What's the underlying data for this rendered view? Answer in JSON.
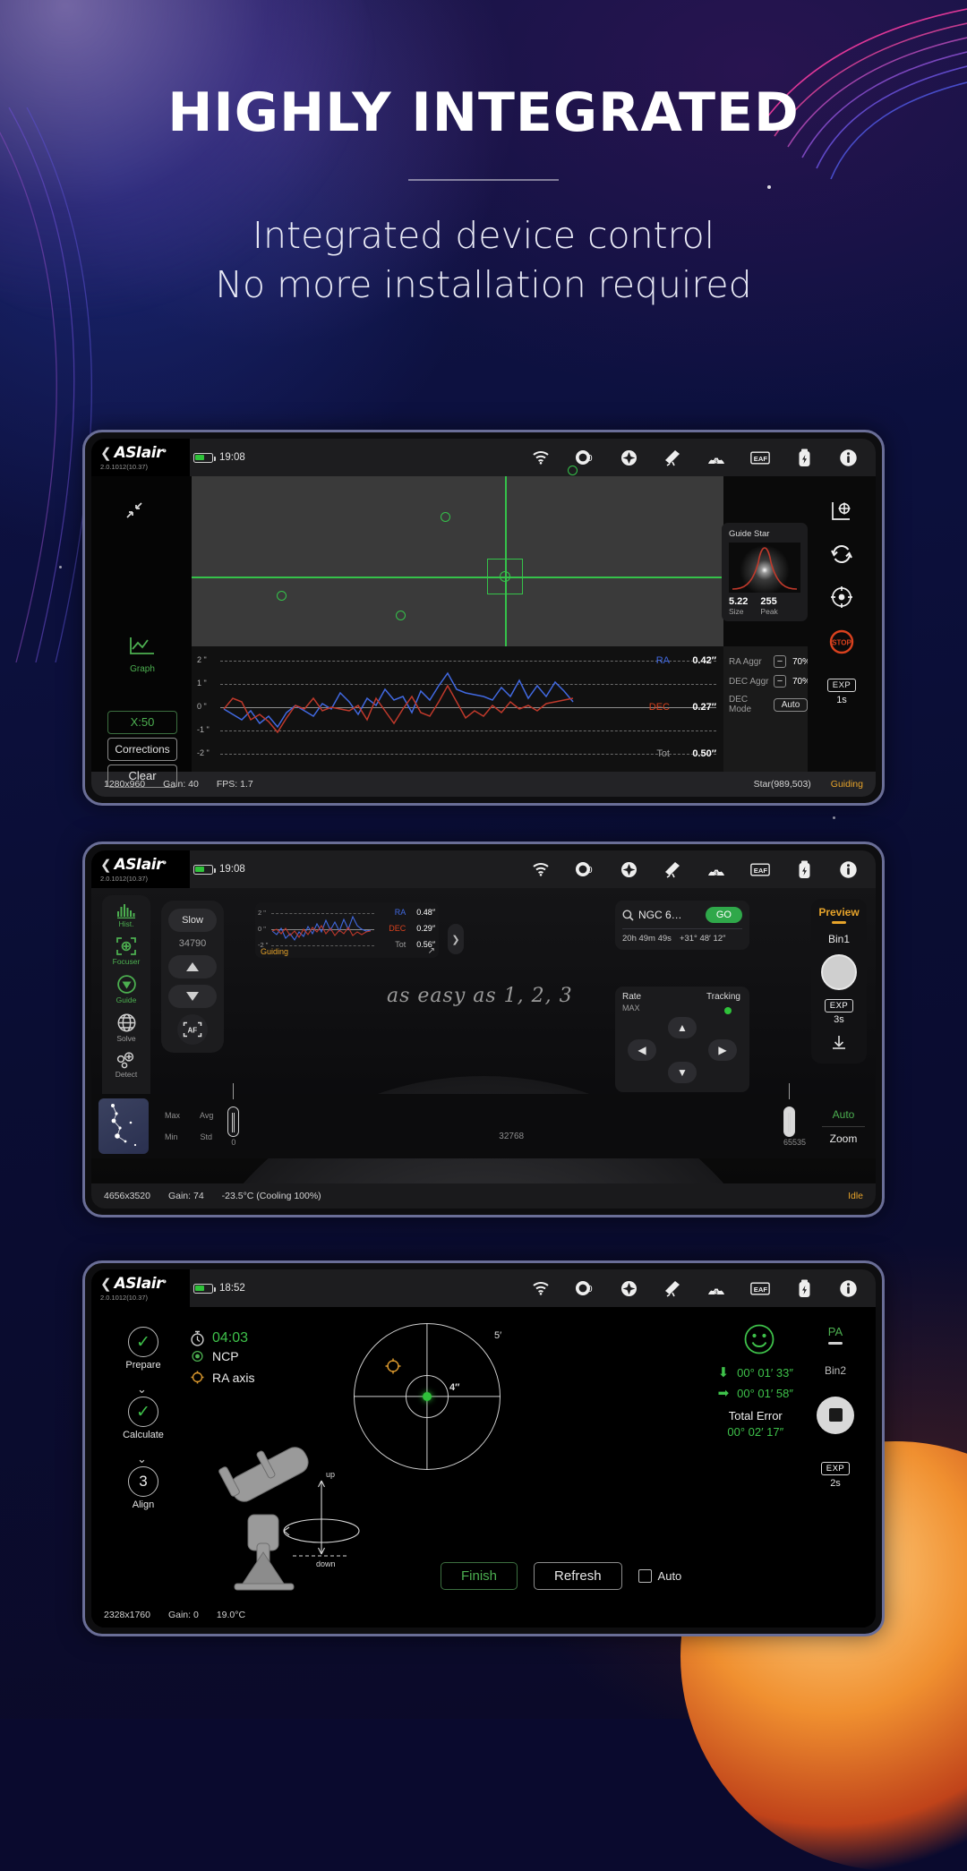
{
  "hero": {
    "headline": "HIGHLY INTEGRATED",
    "subline1": "Integrated device control",
    "subline2": "No more installation required"
  },
  "app": {
    "brand": "ASIair",
    "version": "2.0.1012(10.37)",
    "back_icon": "chevron-left-icon",
    "wifi_icon": "wifi-icon",
    "top_icons": [
      {
        "name": "wifi-icon",
        "label": "WiFi"
      },
      {
        "name": "camera-icon",
        "label": "0"
      },
      {
        "name": "focus-target-icon",
        "label": "Focus"
      },
      {
        "name": "telescope-icon",
        "label": "Mount"
      },
      {
        "name": "filterwheel-icon",
        "label": "3"
      },
      {
        "name": "eaf-icon",
        "label": "EAF"
      },
      {
        "name": "power-icon",
        "label": "Power"
      },
      {
        "name": "info-icon",
        "label": "Info"
      }
    ]
  },
  "panel1": {
    "clock": "19:08",
    "collapse_icon": "collapse-icon",
    "sidebar": {
      "graph_icon": "graph-icon",
      "graph_label": "Graph",
      "buttons": [
        {
          "name": "x-scale-button",
          "label": "X:50",
          "accent": "#4caf50"
        },
        {
          "name": "corrections-button",
          "label": "Corrections",
          "accent": "#e3e3e3"
        },
        {
          "name": "clear-button",
          "label": "Clear",
          "accent": "#e3e3e3"
        }
      ]
    },
    "guide_star": {
      "title": "Guide Star",
      "size_value": "5.22",
      "size_label": "Size",
      "peak_value": "255",
      "peak_label": "Peak"
    },
    "right_tools": [
      {
        "name": "calibrate-icon",
        "label": ""
      },
      {
        "name": "refresh-icon",
        "label": ""
      },
      {
        "name": "target-icon",
        "label": ""
      },
      {
        "name": "stop-icon",
        "label": "STOP"
      }
    ],
    "exposure": {
      "badge": "EXP",
      "value": "1s"
    },
    "graph": {
      "y_labels": [
        "2 \"",
        "1 \"",
        "0 \"",
        "-1 \"",
        "-2 \""
      ],
      "series": [
        {
          "name": "RA",
          "value": "0.42″",
          "color": "#4169e1"
        },
        {
          "name": "DEC",
          "value": "0.27″",
          "color": "#d9411e"
        },
        {
          "name": "Tot",
          "value": "0.50″",
          "color": "#9d9d9d"
        }
      ]
    },
    "settings": [
      {
        "name": "ra-aggr",
        "label": "RA Aggr",
        "value": "70%",
        "minus": "−",
        "plus": "+"
      },
      {
        "name": "dec-aggr",
        "label": "DEC Aggr",
        "value": "70%",
        "minus": "−",
        "plus": "+"
      }
    ],
    "dec_mode": {
      "label": "DEC Mode",
      "value": "Auto"
    },
    "status": {
      "resolution": "1280x960",
      "gain": "Gain: 40",
      "fps": "FPS: 1.7",
      "star": "Star(989,503)",
      "state": "Guiding"
    }
  },
  "panel2": {
    "clock": "19:08",
    "sidebar": [
      {
        "name": "sidebar-item-hist",
        "label": "Hist.",
        "icon": "histogram-icon",
        "active": true
      },
      {
        "name": "sidebar-item-focuser",
        "label": "Focuser",
        "icon": "focuser-icon",
        "active": true
      },
      {
        "name": "sidebar-item-guide",
        "label": "Guide",
        "icon": "guide-icon",
        "active": true
      },
      {
        "name": "sidebar-item-solve",
        "label": "Solve",
        "icon": "globe-icon",
        "active": false
      },
      {
        "name": "sidebar-item-detect",
        "label": "Detect",
        "icon": "detect-icon",
        "active": false
      }
    ],
    "focuser": {
      "speed": "Slow",
      "position": "34790",
      "up_icon": "triangle-up-icon",
      "down_icon": "triangle-down-icon",
      "af_label": "AF"
    },
    "guide_widget": {
      "y_labels": [
        "2 \"",
        "0 \"",
        "-2 \""
      ],
      "series": [
        {
          "name": "RA",
          "value": "0.48″",
          "color": "#4169e1"
        },
        {
          "name": "DEC",
          "value": "0.29″",
          "color": "#d9411e"
        },
        {
          "name": "Tot",
          "value": "0.56″",
          "color": "#9d9d9d"
        }
      ],
      "state": "Guiding",
      "expand_icon": "expand-icon"
    },
    "goto": {
      "search_icon": "search-icon",
      "target": "NGC 6…",
      "go_label": "GO",
      "ra": "20h 49m 49s",
      "dec": "+31° 48′ 12″"
    },
    "rate": {
      "label": "Rate",
      "value": "MAX"
    },
    "tracking": {
      "label": "Tracking",
      "on": true
    },
    "dpad": [
      "▲",
      "▼",
      "◀",
      "▶"
    ],
    "right": {
      "mode": "Preview",
      "bin": "Bin1",
      "shutter_icon": "shutter-icon",
      "exp_badge": "EXP",
      "exp_value": "3s",
      "save_icon": "download-icon"
    },
    "script_text": "as easy as 1, 2, 3",
    "histogram": {
      "max_label": "Max",
      "avg_label": "Avg",
      "min_label": "Min",
      "std_label": "Std",
      "low": "0",
      "mid": "32768",
      "high": "65535",
      "auto": "Auto",
      "zoom": "Zoom"
    },
    "status": {
      "resolution": "4656x3520",
      "gain": "Gain: 74",
      "temp": "-23.5°C (Cooling 100%)",
      "state": "Idle"
    }
  },
  "panel3": {
    "clock": "18:52",
    "steps": [
      {
        "name": "step-prepare",
        "label": "Prepare",
        "mark": "✓",
        "done": true
      },
      {
        "name": "step-calculate",
        "label": "Calculate",
        "mark": "✓",
        "done": true
      },
      {
        "name": "step-align",
        "label": "Align",
        "mark": "3",
        "done": false
      }
    ],
    "info": {
      "timer_icon": "timer-icon",
      "timer": "04:03",
      "ncp_icon": "ncp-dot-icon",
      "ncp": "NCP",
      "ra_axis_icon": "ra-axis-icon",
      "ra_axis": "RA axis"
    },
    "polar": {
      "outer_label": "5′",
      "inner_label": "4″"
    },
    "result": {
      "face_icon": "smiley-icon",
      "rows": [
        {
          "name": "error-alt",
          "arrow": "⬇",
          "value": "00° 01′ 33″"
        },
        {
          "name": "error-az",
          "arrow": "➡",
          "value": "00° 01′ 58″"
        }
      ],
      "total_label": "Total Error",
      "total_value": "00° 02′ 17″"
    },
    "right": {
      "mode": "PA",
      "bin": "Bin2",
      "stop_icon": "stop-square-icon",
      "exp_badge": "EXP",
      "exp_value": "2s"
    },
    "actions": [
      {
        "name": "finish-button",
        "label": "Finish",
        "accent": "#4caf50"
      },
      {
        "name": "refresh-button",
        "label": "Refresh",
        "accent": "#e8e8e8"
      }
    ],
    "auto": {
      "label": "Auto",
      "checked": false
    },
    "status": {
      "resolution": "2328x1760",
      "gain": "Gain: 0",
      "temp": "19.0°C"
    }
  },
  "theme": {
    "green": "#4caf50",
    "amber": "#e6a32a",
    "blue": "#4169e1",
    "red": "#d9411e"
  }
}
